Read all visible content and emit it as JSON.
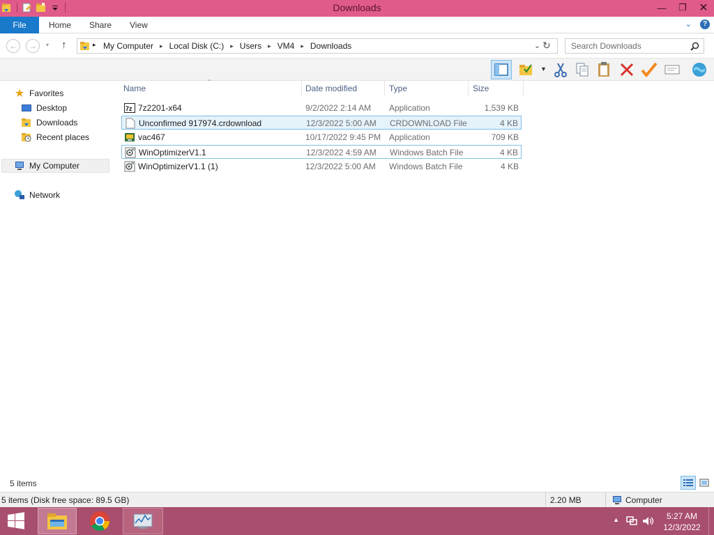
{
  "window": {
    "title": "Downloads"
  },
  "ribbon": {
    "file": "File",
    "tabs": [
      "Home",
      "Share",
      "View"
    ]
  },
  "address": {
    "crumbs": [
      "My Computer",
      "Local Disk (C:)",
      "Users",
      "VM4",
      "Downloads"
    ],
    "search_placeholder": "Search Downloads"
  },
  "nav": {
    "favorites": "Favorites",
    "desktop": "Desktop",
    "downloads": "Downloads",
    "recent": "Recent places",
    "computer": "My Computer",
    "network": "Network"
  },
  "columns": {
    "name": "Name",
    "date": "Date modified",
    "type": "Type",
    "size": "Size"
  },
  "files": [
    {
      "name": "7z2201-x64",
      "date": "9/2/2022 2:14 AM",
      "type": "Application",
      "size": "1,539 KB",
      "icon": "7zip-app-icon"
    },
    {
      "name": "Unconfirmed 917974.crdownload",
      "date": "12/3/2022 5:00 AM",
      "type": "CRDOWNLOAD File",
      "size": "4 KB",
      "icon": "blank-file-icon"
    },
    {
      "name": "vac467",
      "date": "10/17/2022 9:45 PM",
      "type": "Application",
      "size": "709 KB",
      "icon": "app-installer-icon"
    },
    {
      "name": "WinOptimizerV1.1",
      "date": "12/3/2022 4:59 AM",
      "type": "Windows Batch File",
      "size": "4 KB",
      "icon": "batch-file-icon"
    },
    {
      "name": "WinOptimizerV1.1 (1)",
      "date": "12/3/2022 5:00 AM",
      "type": "Windows Batch File",
      "size": "4 KB",
      "icon": "batch-file-icon"
    }
  ],
  "items_count": "5 items",
  "status": {
    "left": "5 items (Disk free space: 89.5 GB)",
    "size": "2.20 MB",
    "location": "Computer"
  },
  "clock": {
    "time": "5:27 AM",
    "date": "12/3/2022"
  },
  "colors": {
    "titlebar": "#e05b8c",
    "taskbar": "#a84e6e",
    "file_tab": "#1979ca",
    "selection": "#e5f3fb"
  }
}
